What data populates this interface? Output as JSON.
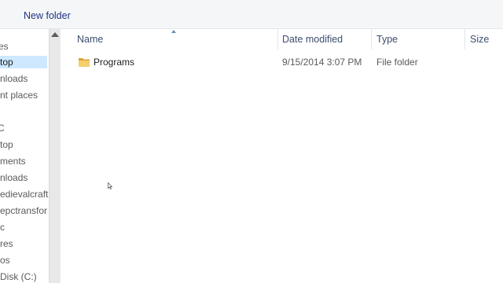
{
  "toolbar": {
    "new_folder_label": "New folder"
  },
  "navigation": {
    "items": [
      {
        "label": "es",
        "selected": false
      },
      {
        "label": "top",
        "selected": true
      },
      {
        "label": "nloads",
        "selected": false
      },
      {
        "label": "nt places",
        "selected": false
      },
      {
        "label": "C",
        "selected": false
      },
      {
        "label": "top",
        "selected": false
      },
      {
        "label": "ments",
        "selected": false
      },
      {
        "label": "nloads",
        "selected": false
      },
      {
        "label": "edievalcraft",
        "selected": false
      },
      {
        "label": "epctransfor",
        "selected": false
      },
      {
        "label": "c",
        "selected": false
      },
      {
        "label": "res",
        "selected": false
      },
      {
        "label": "os",
        "selected": false
      },
      {
        "label": "Disk (C:)",
        "selected": false
      }
    ]
  },
  "file_list": {
    "columns": {
      "name": "Name",
      "date_modified": "Date modified",
      "type": "Type",
      "size": "Size"
    },
    "rows": [
      {
        "name": "Programs",
        "date_modified": "9/15/2014 3:07 PM",
        "type": "File folder",
        "size": ""
      }
    ]
  },
  "colors": {
    "toolbar_bg": "#f5f6f7",
    "selection": "#cde8ff",
    "header_text": "#3c4d6e",
    "folder": "#e8b94a"
  },
  "icons": [
    "folder-icon",
    "scroll-up-icon",
    "sort-ascending-icon",
    "mouse-cursor-icon"
  ]
}
